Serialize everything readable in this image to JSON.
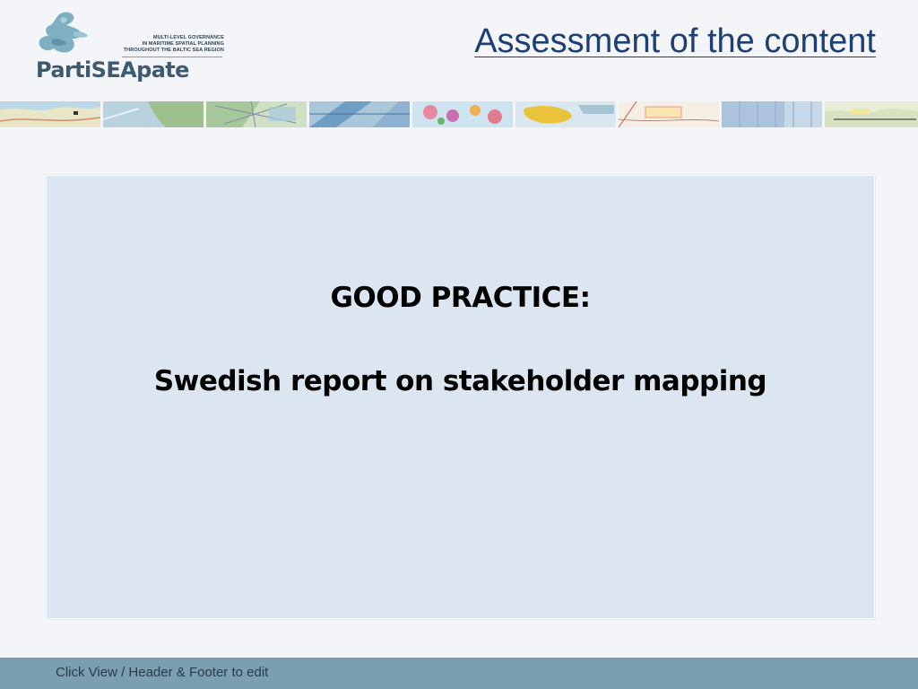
{
  "logo": {
    "name": "PartiSEApate",
    "tagline_lines": [
      "MULTI-LEVEL GOVERNANCE",
      "IN MARITIME SPATIAL PLANNING",
      "THROUGHOUT THE BALTIC SEA REGION"
    ]
  },
  "header": {
    "title": "Assessment of the content"
  },
  "slide": {
    "heading": "GOOD PRACTICE:",
    "subheading": "Swedish report on stakeholder mapping"
  },
  "footer": {
    "text": "Click View / Header & Footer to edit"
  },
  "colors": {
    "title": "#1d3f73",
    "content_bg": "#dce6f1",
    "footer_bg": "#7b9eb0",
    "page_bg": "#f3f5f8"
  }
}
